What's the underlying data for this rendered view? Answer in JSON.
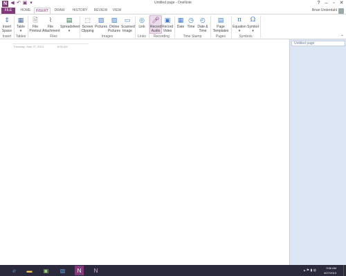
{
  "window": {
    "title": "Untitled page - OneNote"
  },
  "tabs": [
    "FILE",
    "HOME",
    "INSERT",
    "DRAW",
    "HISTORY",
    "REVIEW",
    "VIEW"
  ],
  "active_tab": "INSERT",
  "user": {
    "name": "Brian Underdahl"
  },
  "ribbon": {
    "insert_space": "Insert\nSpace",
    "table": "Table",
    "file_printout": "File\nPrintout",
    "file_attachment": "File\nAttachment",
    "spreadsheet": "Spreadsheet",
    "screen_clipping": "Screen\nClipping",
    "pictures": "Pictures",
    "online_pictures": "Online\nPictures",
    "scanned_image": "Scanned\nImage",
    "link": "Link",
    "record_audio": "Record\nAudio",
    "record_video": "Record\nVideo",
    "date": "Date",
    "time": "Time",
    "date_time": "Date &\nTime",
    "page_templates": "Page\nTemplates",
    "equation": "Equation",
    "symbol": "Symbol",
    "groups": {
      "insert": "Insert",
      "tables": "Tables",
      "files": "Files",
      "images": "Images",
      "links": "Links",
      "recording": "Recording",
      "time_stamp": "Time Stamp",
      "pages": "Pages",
      "symbols": "Symbols"
    }
  },
  "page": {
    "date": "Thursday, June 27, 2013",
    "time": "8:55 AM"
  },
  "page_list": [
    "Untitled page"
  ],
  "taskbar": {
    "clock_time": "9:56 AM",
    "clock_date": "6/27/2013"
  },
  "colors": {
    "accent": "#80397b",
    "page_pane": "#dce6f4",
    "taskbar": "#2a2a3c"
  }
}
